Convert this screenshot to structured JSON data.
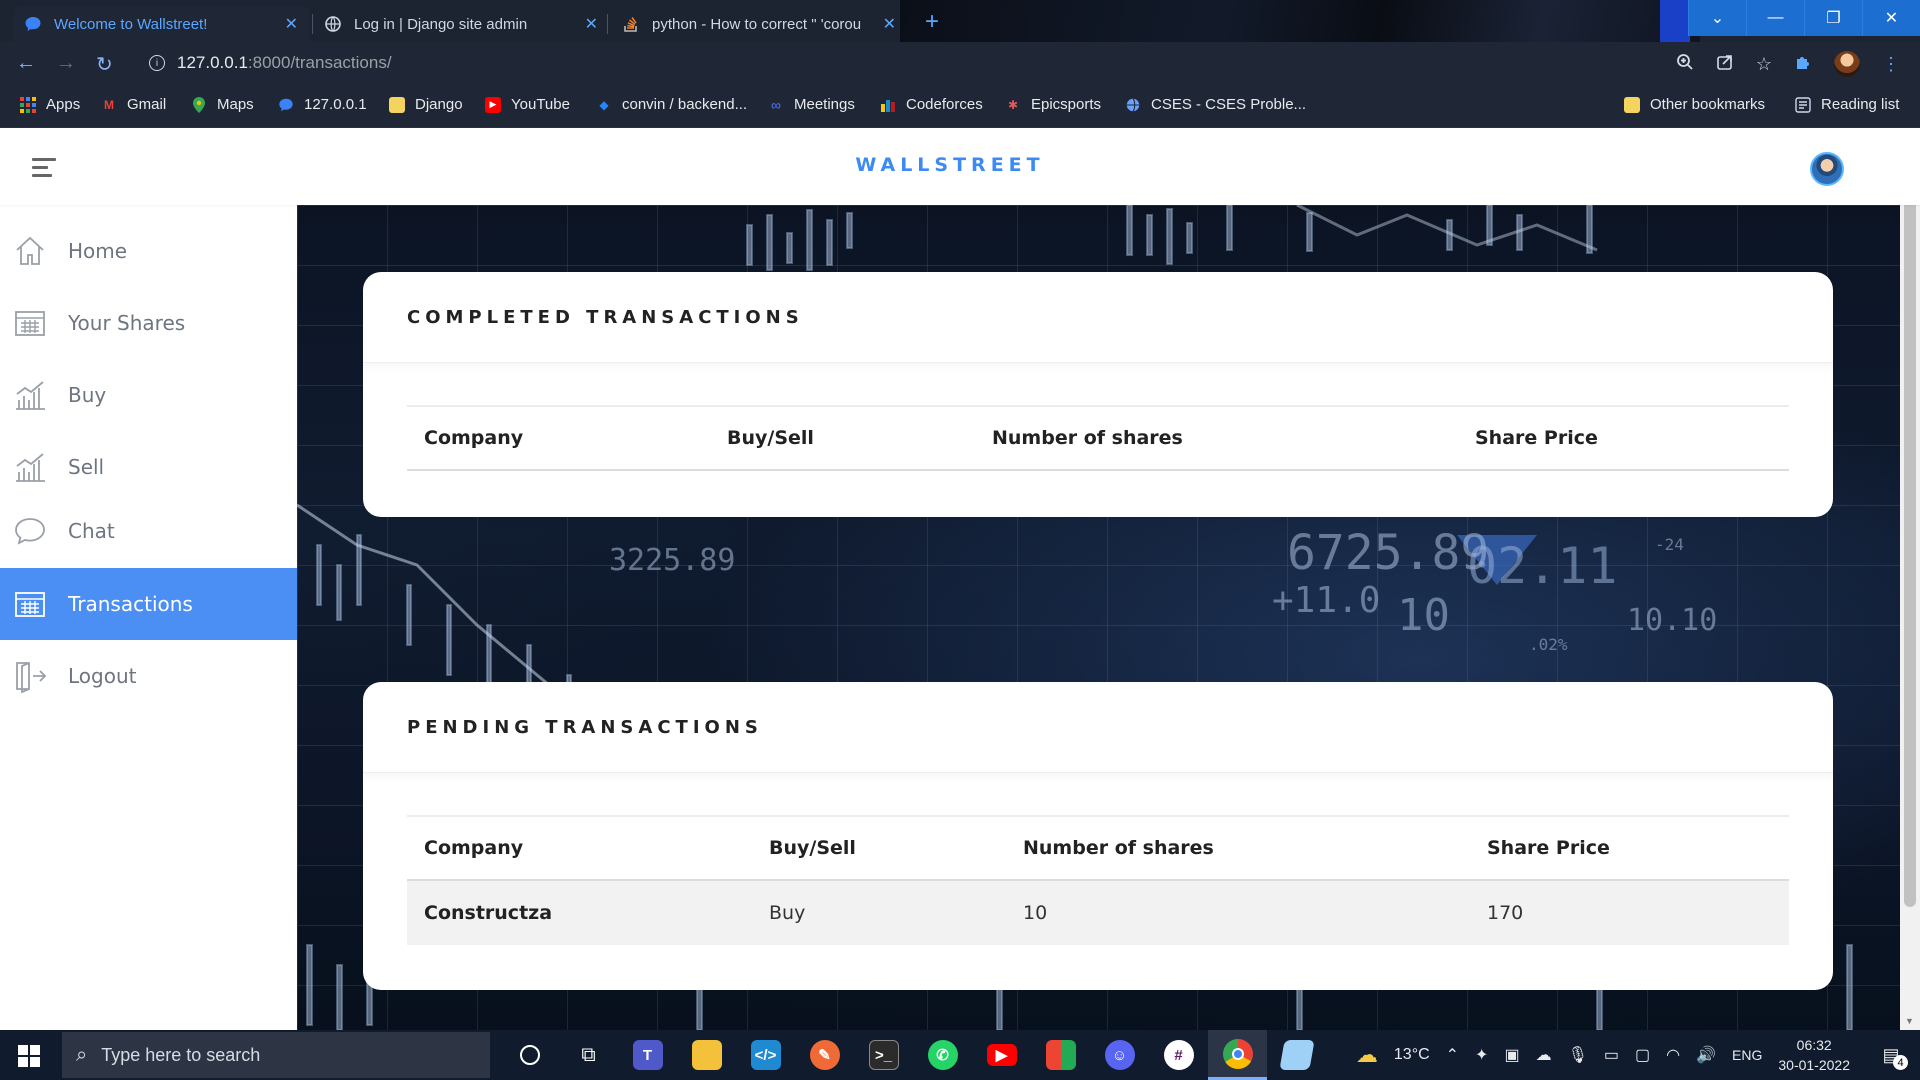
{
  "browser": {
    "tabs": [
      {
        "title": "Welcome to Wallstreet!",
        "active": true
      },
      {
        "title": "Log in | Django site admin",
        "active": false
      },
      {
        "title": "python - How to correct \" 'corou",
        "active": false
      }
    ],
    "url_host": "127.0.0.1",
    "url_path": ":8000/transactions/",
    "bookmarks": [
      {
        "label": "Apps",
        "icon": "apps-grid-icon",
        "color": "#ea4335"
      },
      {
        "label": "Gmail",
        "icon": "gmail-icon",
        "color": "#ea4335"
      },
      {
        "label": "Maps",
        "icon": "maps-icon",
        "color": "#34a853"
      },
      {
        "label": "127.0.0.1",
        "icon": "chat-bubble-icon",
        "color": "#3b82f6"
      },
      {
        "label": "Django",
        "icon": "folder-icon",
        "color": "#f4d35e"
      },
      {
        "label": "YouTube",
        "icon": "youtube-icon",
        "color": "#ff0000"
      },
      {
        "label": "convin / backend...",
        "icon": "bitbucket-icon",
        "color": "#2684ff"
      },
      {
        "label": "Meetings",
        "icon": "meetings-icon",
        "color": "#4a7dff"
      },
      {
        "label": "Codeforces",
        "icon": "codeforces-icon",
        "color": "#f5c518"
      },
      {
        "label": "Epicsports",
        "icon": "epicsports-icon",
        "color": "#e05a5a"
      },
      {
        "label": "CSES - CSES Proble...",
        "icon": "globe-icon",
        "color": "#6aa0ff"
      }
    ],
    "other_bookmarks": "Other bookmarks",
    "reading_list": "Reading list"
  },
  "app": {
    "brand": "WALLSTREET",
    "accent": "#4b8ff5",
    "sidebar": [
      {
        "label": "Home",
        "icon": "home-icon",
        "active": false
      },
      {
        "label": "Your Shares",
        "icon": "table-icon",
        "active": false
      },
      {
        "label": "Buy",
        "icon": "chart-bars-icon",
        "active": false
      },
      {
        "label": "Sell",
        "icon": "chart-bars-icon",
        "active": false
      },
      {
        "label": "Chat",
        "icon": "chat-icon",
        "active": false
      },
      {
        "label": "Transactions",
        "icon": "table-icon",
        "active": true
      },
      {
        "label": "Logout",
        "icon": "logout-icon",
        "active": false
      }
    ]
  },
  "completed": {
    "title": "COMPLETED TRANSACTIONS",
    "columns": [
      "Company",
      "Buy/Sell",
      "Number of shares",
      "Share Price"
    ],
    "rows": []
  },
  "pending": {
    "title": "PENDING TRANSACTIONS",
    "columns": [
      "Company",
      "Buy/Sell",
      "Number of shares",
      "Share Price"
    ],
    "rows": [
      {
        "company": "Constructza",
        "type": "Buy",
        "shares": "10",
        "price": "170"
      }
    ]
  },
  "background_tickers": [
    "3225.89",
    "6725.89",
    "02.11",
    "+11.0",
    "10",
    "10.10",
    "-24",
    ".02%"
  ],
  "taskbar": {
    "search_placeholder": "Type here to search",
    "temperature": "13°C",
    "language": "ENG",
    "time": "06:32",
    "date": "30-01-2022",
    "notifications": "4"
  }
}
